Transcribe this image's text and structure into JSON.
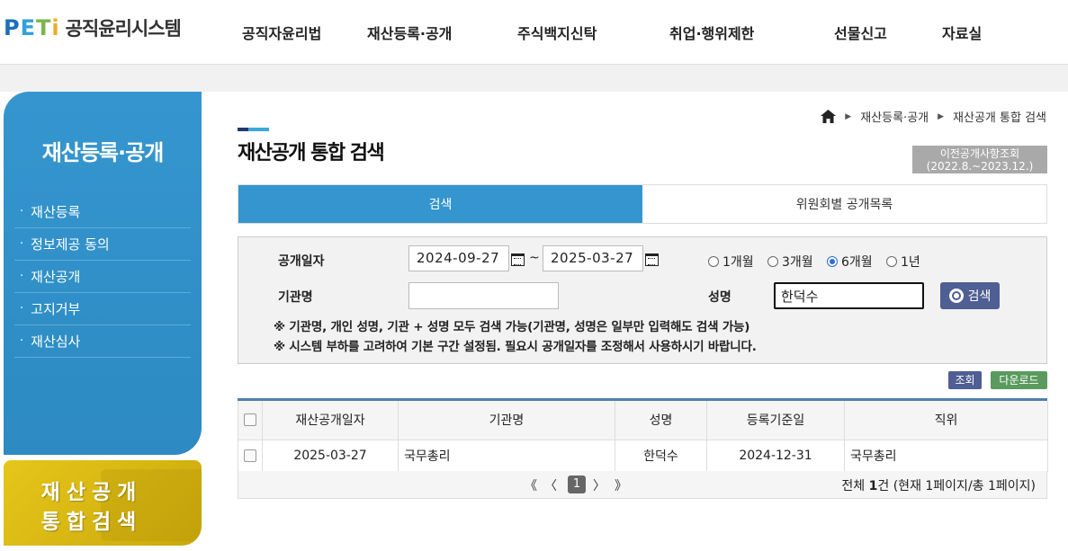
{
  "header": {
    "logo_text": "PETi",
    "logo_name": "공직윤리시스템",
    "nav": [
      "공직자윤리법",
      "재산등록·공개",
      "주식백지신탁",
      "취업·행위제한",
      "선물신고",
      "자료실"
    ]
  },
  "sidebar": {
    "title": "재산등록·공개",
    "items": [
      {
        "label": "재산등록"
      },
      {
        "label": "정보제공 동의"
      },
      {
        "label": "재산공개"
      },
      {
        "label": "고지거부"
      },
      {
        "label": "재산심사"
      }
    ],
    "banner_line1": "재산공개",
    "banner_line2": "통합검색"
  },
  "breadcrumb": [
    "재산등록·공개",
    "재산공개 통합 검색"
  ],
  "page_title": "재산공개 통합 검색",
  "prev_button": {
    "line1": "이전공개사항조회",
    "line2": "(2022.8.~2023.12.)"
  },
  "tabs": [
    {
      "label": "검색",
      "active": true
    },
    {
      "label": "위원회별 공개목록",
      "active": false
    }
  ],
  "search": {
    "date_label": "공개일자",
    "date_from": "2024-09-27",
    "tilde": "~",
    "date_to": "2025-03-27",
    "periods": [
      {
        "label": "1개월",
        "checked": false
      },
      {
        "label": "3개월",
        "checked": false
      },
      {
        "label": "6개월",
        "checked": true
      },
      {
        "label": "1년",
        "checked": false
      }
    ],
    "org_label": "기관명",
    "org_value": "",
    "name_label": "성명",
    "name_value": "한덕수",
    "search_button": "검색",
    "note1": "※ 기관명, 개인 성명, 기관 + 성명 모두 검색 가능(기관명, 성명은 일부만 입력해도 검색 가능)",
    "note2": "※ 시스템 부하를 고려하여 기본 구간 설정됨. 필요시 공개일자를 조정해서 사용하시기 바랍니다."
  },
  "actions": {
    "view_label": "조회",
    "download_label": "다운로드",
    "view_color": "#4f5e93",
    "download_color": "#5a9a5e"
  },
  "table": {
    "headers": [
      "재산공개일자",
      "기관명",
      "성명",
      "등록기준일",
      "직위"
    ],
    "rows": [
      {
        "date": "2025-03-27",
        "org": "국무총리",
        "name": "한덕수",
        "base_date": "2024-12-31",
        "position": "국무총리"
      }
    ]
  },
  "pagination": {
    "first": "《",
    "prev": "〈",
    "current": "1",
    "next": "〉",
    "last": "》",
    "total_prefix": "전체 ",
    "total_count": "1",
    "total_suffix": "건 (현재 1페이지/총 1페이지)"
  },
  "colors": {
    "accent": "#3596cf",
    "title_dark": "#1e3a6e",
    "banner": "#e6c61a"
  }
}
